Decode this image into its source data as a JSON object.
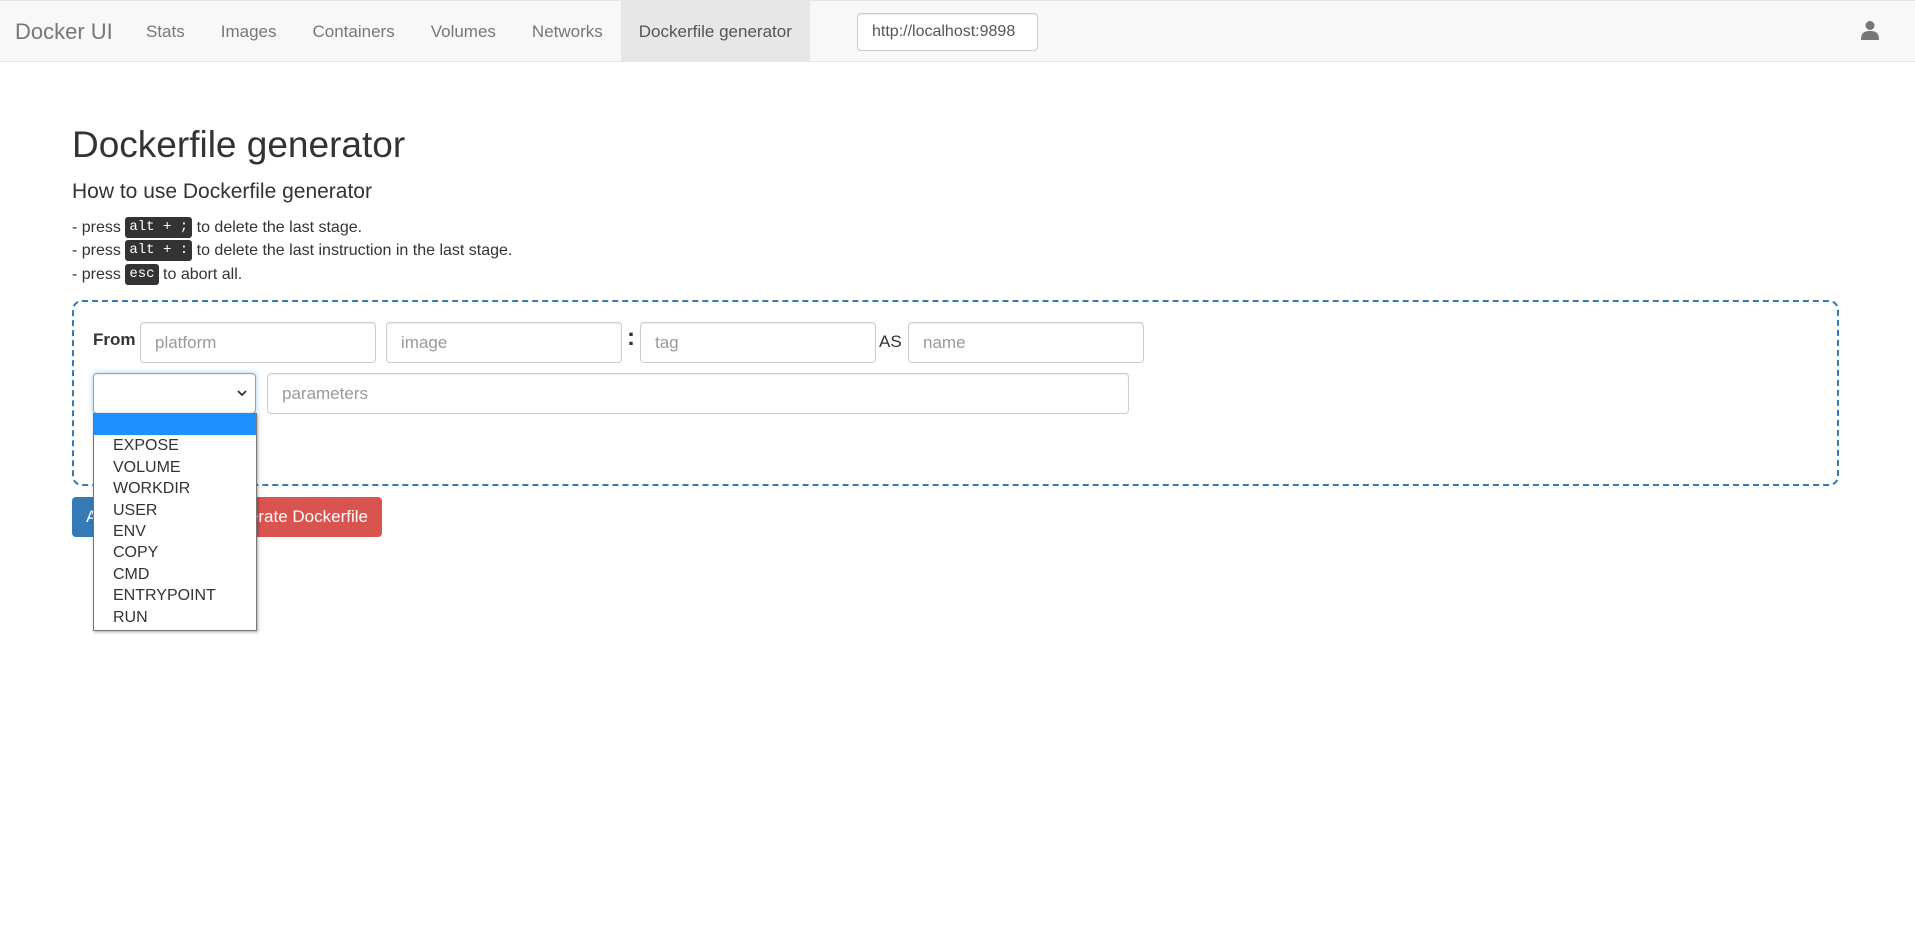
{
  "navbar": {
    "brand": "Docker UI",
    "items": [
      {
        "label": "Stats"
      },
      {
        "label": "Images"
      },
      {
        "label": "Containers"
      },
      {
        "label": "Volumes"
      },
      {
        "label": "Networks"
      },
      {
        "label": "Dockerfile generator",
        "active": true
      }
    ],
    "endpoint_value": "http://localhost:9898",
    "user_icon": "user-icon"
  },
  "page": {
    "title": "Dockerfile generator",
    "subtitle": "How to use Dockerfile generator",
    "hints": [
      {
        "prefix": "- press",
        "key": "alt + ;",
        "suffix": "to delete the last stage."
      },
      {
        "prefix": "- press",
        "key": "alt + :",
        "suffix": "to delete the last instruction in the last stage."
      },
      {
        "prefix": "- press",
        "key": "esc",
        "suffix": "to abort all."
      }
    ]
  },
  "stage": {
    "from_label": "From",
    "platform_placeholder": "platform",
    "image_placeholder": "image",
    "colon": ":",
    "tag_placeholder": "tag",
    "as_label": "AS",
    "name_placeholder": "name",
    "instruction_value": "",
    "parameters_placeholder": "parameters",
    "instruction_options": [
      "",
      "EXPOSE",
      "VOLUME",
      "WORKDIR",
      "USER",
      "ENV",
      "COPY",
      "CMD",
      "ENTRYPOINT",
      "RUN"
    ],
    "selected_option_index": 0
  },
  "buttons": {
    "add_label": "A",
    "generate_label": "erate Dockerfile"
  },
  "colors": {
    "primary": "#337ab7",
    "danger": "#d9534f",
    "selected_option": "#1e90ff"
  }
}
